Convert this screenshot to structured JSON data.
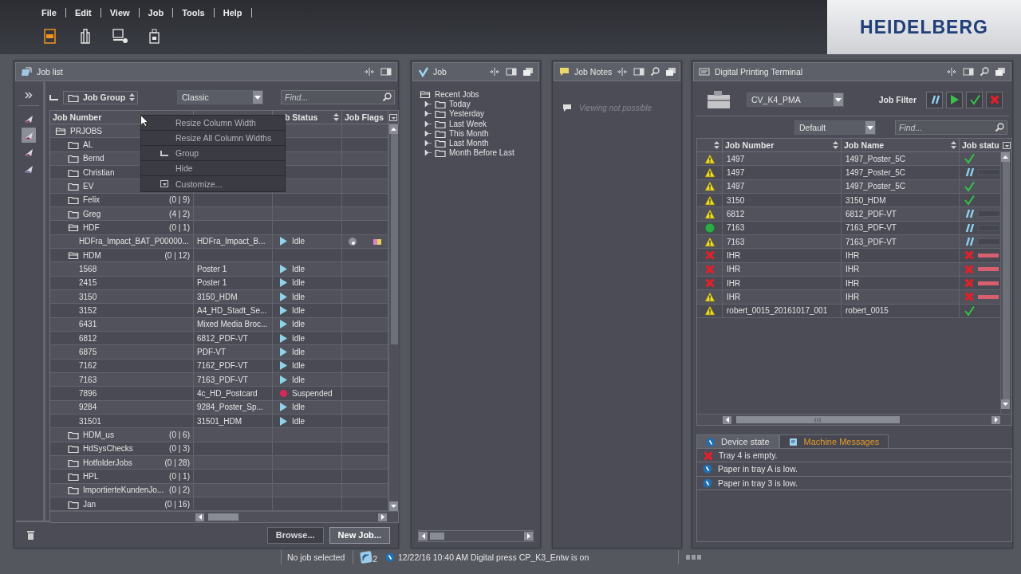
{
  "menu": [
    {
      "label": "File"
    },
    {
      "label": "Edit"
    },
    {
      "label": "View"
    },
    {
      "label": "Job"
    },
    {
      "label": "Tools"
    },
    {
      "label": "Help"
    }
  ],
  "toolbar": [
    {
      "kind": "document",
      "selected": true
    },
    {
      "kind": "press",
      "selected": false
    },
    {
      "kind": "monitor",
      "selected": false
    },
    {
      "kind": "device",
      "selected": false
    }
  ],
  "logo": "HEIDELBERG",
  "job_list": {
    "title": "Job list",
    "group_by": "Job Group",
    "view": "Classic",
    "find_placeholder": "Find...",
    "side_tools": [
      {
        "selected": false
      },
      {
        "selected": true
      },
      {
        "selected": false
      },
      {
        "selected": false
      }
    ],
    "columns": {
      "column_1": "Job Number",
      "column_3": "b Status",
      "column_4": "Job Flags"
    },
    "tree": [
      {
        "kind": "group",
        "label": "PRJOBS",
        "expanded": true,
        "children": [
          {
            "kind": "group",
            "label": "AL",
            "expanded": false
          },
          {
            "kind": "group",
            "label": "Bernd",
            "expanded": false
          },
          {
            "kind": "group",
            "label": "Christian",
            "expanded": false
          },
          {
            "kind": "group",
            "label": "EV",
            "expanded": false
          },
          {
            "kind": "group",
            "label": "Felix",
            "count": "(0 | 9)",
            "expanded": false
          },
          {
            "kind": "group",
            "label": "Greg",
            "count": "(4 | 2)",
            "expanded": false
          },
          {
            "kind": "group",
            "label": "HDF",
            "count": "(0 | 1)",
            "expanded": true,
            "children": [
              {
                "kind": "job",
                "number": "HDFra_Impact_BAT_P00000...",
                "name": "HDFra_Impact_B...",
                "status": "Idle",
                "suspended": false,
                "flags": true
              }
            ]
          },
          {
            "kind": "group",
            "label": "HDM",
            "count": "(0 | 12)",
            "expanded": true,
            "children": [
              {
                "kind": "job",
                "number": "1568",
                "name": "Poster 1",
                "status": "Idle",
                "suspended": false,
                "flags": false
              },
              {
                "kind": "job",
                "number": "2415",
                "name": "Poster 1",
                "status": "Idle",
                "suspended": false,
                "flags": false
              },
              {
                "kind": "job",
                "number": "3150",
                "name": "3150_HDM",
                "status": "Idle",
                "suspended": false,
                "flags": false
              },
              {
                "kind": "job",
                "number": "3152",
                "name": "A4_HD_Stadt_Se...",
                "status": "Idle",
                "suspended": false,
                "flags": false
              },
              {
                "kind": "job",
                "number": "6431",
                "name": "Mixed Media Broc...",
                "status": "Idle",
                "suspended": false,
                "flags": false
              },
              {
                "kind": "job",
                "number": "6812",
                "name": "6812_PDF-VT",
                "status": "Idle",
                "suspended": false,
                "flags": false
              },
              {
                "kind": "job",
                "number": "6875",
                "name": "PDF-VT",
                "status": "Idle",
                "suspended": false,
                "flags": false
              },
              {
                "kind": "job",
                "number": "7162",
                "name": "7162_PDF-VT",
                "status": "Idle",
                "suspended": false,
                "flags": false
              },
              {
                "kind": "job",
                "number": "7163",
                "name": "7163_PDF-VT",
                "status": "Idle",
                "suspended": false,
                "flags": false
              },
              {
                "kind": "job",
                "number": "7896",
                "name": "4c_HD_Postcard",
                "status": "Suspended",
                "suspended": true,
                "flags": false
              },
              {
                "kind": "job",
                "number": "9284",
                "name": "9284_Poster_Sp...",
                "status": "Idle",
                "suspended": false,
                "flags": false
              },
              {
                "kind": "job",
                "number": "31501",
                "name": "31501_HDM",
                "status": "Idle",
                "suspended": false,
                "flags": false
              }
            ]
          },
          {
            "kind": "group",
            "label": "HDM_us",
            "count": "(0 | 6)",
            "expanded": false
          },
          {
            "kind": "group",
            "label": "HdSysChecks",
            "count": "(0 | 3)",
            "expanded": false
          },
          {
            "kind": "group",
            "label": "HotfolderJobs",
            "count": "(0 | 28)",
            "expanded": false
          },
          {
            "kind": "group",
            "label": "HPL",
            "count": "(0 | 1)",
            "expanded": false
          },
          {
            "kind": "group",
            "label": "ImportierteKundenJo...",
            "count": "(0 | 2)",
            "expanded": false
          },
          {
            "kind": "group",
            "label": "Jan",
            "count": "(0 | 16)",
            "expanded": false
          }
        ]
      }
    ],
    "context_menu": [
      {
        "label": "Resize Column Width"
      },
      {
        "label": "Resize All Column Widths"
      },
      {
        "label": "Group"
      },
      {
        "label": "Hide"
      },
      {
        "label": "Customize..."
      }
    ],
    "buttons": [
      {
        "label": "Browse...",
        "disabled": true
      },
      {
        "label": "New Job...",
        "disabled": false
      }
    ]
  },
  "job": {
    "title": "Job",
    "tree": {
      "label": "Recent Jobs",
      "expanded": true,
      "children": [
        {
          "label": "Today",
          "expanded": false
        },
        {
          "label": "Yesterday",
          "expanded": false
        },
        {
          "label": "Last Week",
          "expanded": false
        },
        {
          "label": "This Month",
          "expanded": false
        },
        {
          "label": "Last Month",
          "expanded": false
        },
        {
          "label": "Month Before Last",
          "expanded": false
        }
      ]
    }
  },
  "job_notes": {
    "title": "Job Notes",
    "message": "Viewing not possible"
  },
  "terminal": {
    "title": "Digital Printing Terminal",
    "device": "CV_K4_PMA",
    "filter_label": "Job Filter",
    "filters": [
      {
        "kind": "paused"
      },
      {
        "kind": "play"
      },
      {
        "kind": "done"
      },
      {
        "kind": "error"
      }
    ],
    "view": "Default",
    "find_placeholder": "Find...",
    "columns": {
      "column_2": "Job Number",
      "column_3": "Job Name",
      "column_4": "Job statu"
    },
    "rows": [
      {
        "kind": "warning",
        "number": "1497",
        "name": "1497_Poster_5C",
        "job_status": {
          "kind": "done"
        }
      },
      {
        "kind": "warning",
        "number": "1497",
        "name": "1497_Poster_5C",
        "job_status": {
          "kind": "paused"
        }
      },
      {
        "kind": "warning",
        "number": "1497",
        "name": "1497_Poster_5C",
        "job_status": {
          "kind": "done"
        }
      },
      {
        "kind": "warning",
        "number": "3150",
        "name": "3150_HDM",
        "job_status": {
          "kind": "done"
        }
      },
      {
        "kind": "warning",
        "number": "6812",
        "name": "6812_PDF-VT",
        "job_status": {
          "kind": "paused"
        }
      },
      {
        "kind": "ok",
        "number": "7163",
        "name": "7163_PDF-VT",
        "job_status": {
          "kind": "paused"
        }
      },
      {
        "kind": "warning",
        "number": "7163",
        "name": "7163_PDF-VT",
        "job_status": {
          "kind": "paused"
        }
      },
      {
        "kind": "error",
        "number": "IHR",
        "name": "IHR",
        "job_status": {
          "kind": "error"
        }
      },
      {
        "kind": "error",
        "number": "IHR",
        "name": "IHR",
        "job_status": {
          "kind": "error"
        }
      },
      {
        "kind": "error",
        "number": "IHR",
        "name": "IHR",
        "job_status": {
          "kind": "error"
        }
      },
      {
        "kind": "warning",
        "number": "IHR",
        "name": "IHR",
        "job_status": {
          "kind": "error"
        }
      },
      {
        "kind": "warning",
        "number": "robert_0015_20161017_001",
        "name": "robert_0015",
        "job_status": {
          "kind": "done"
        }
      }
    ],
    "tabs": [
      {
        "label": "Device state",
        "selected": false
      },
      {
        "label": "Machine Messages",
        "selected": true
      }
    ],
    "messages": [
      {
        "kind": "error",
        "text": "Tray 4 is empty."
      },
      {
        "kind": "info",
        "text": "Paper in tray A is low."
      },
      {
        "kind": "info",
        "text": "Paper in tray 3 is low."
      }
    ]
  },
  "status_bar": {
    "selection": "No job selected",
    "queue_count": "2",
    "message": "12/22/16 10:40 AM Digital press CP_K3_Entw is on"
  }
}
